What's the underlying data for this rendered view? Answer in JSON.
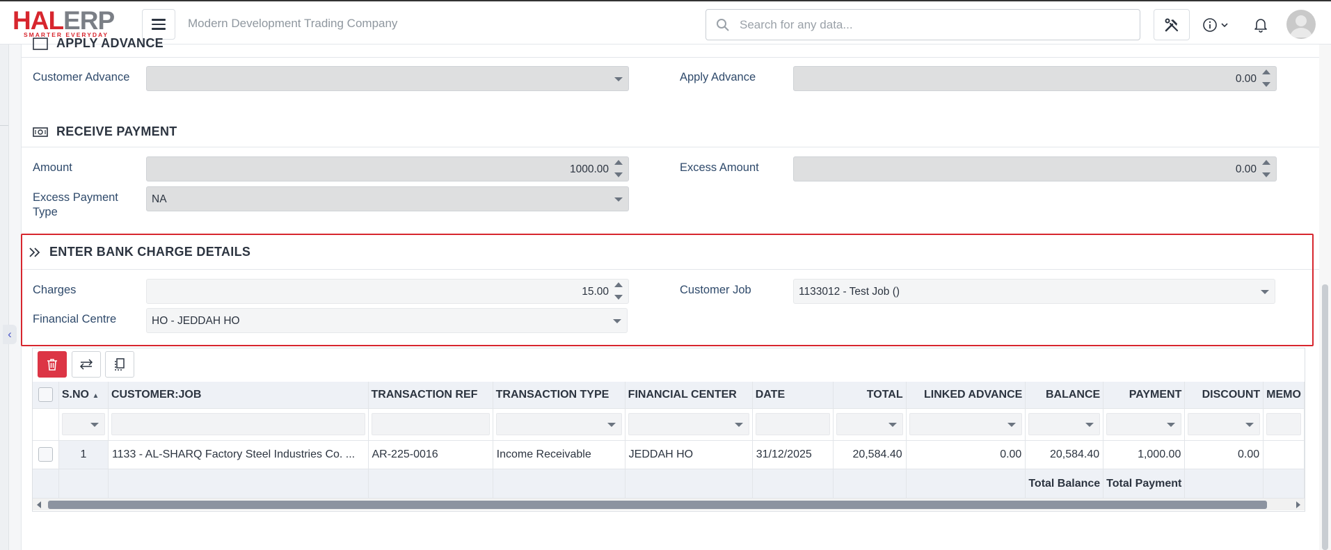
{
  "header": {
    "logo_hal": "HAL",
    "logo_erp": "ERP",
    "logo_tagline": "SMARTER EVERYDAY",
    "company_name": "Modern Development Trading Company",
    "search_placeholder": "Search for any data..."
  },
  "apply_advance": {
    "section_title": "APPLY ADVANCE",
    "customer_advance_label": "Customer Advance",
    "customer_advance_value": "",
    "apply_advance_label": "Apply Advance",
    "apply_advance_value": "0.00"
  },
  "receive_payment": {
    "section_title": "RECEIVE PAYMENT",
    "amount_label": "Amount",
    "amount_value": "1000.00",
    "excess_amount_label": "Excess Amount",
    "excess_amount_value": "0.00",
    "excess_payment_type_label": "Excess Payment Type",
    "excess_payment_type_value": "NA"
  },
  "bank_charge": {
    "section_title": "ENTER BANK CHARGE DETAILS",
    "charges_label": "Charges",
    "charges_value": "15.00",
    "customer_job_label": "Customer Job",
    "customer_job_value": "1133012 - Test Job ()",
    "financial_centre_label": "Financial Centre",
    "financial_centre_value": "HO - JEDDAH HO"
  },
  "grid": {
    "columns": {
      "sno": "S.NO",
      "customer_job": "CUSTOMER:JOB",
      "transaction_ref": "TRANSACTION REF",
      "transaction_type": "TRANSACTION TYPE",
      "financial_center": "FINANCIAL CENTER",
      "date": "DATE",
      "total": "TOTAL",
      "linked_advance": "LINKED ADVANCE",
      "balance": "BALANCE",
      "payment": "PAYMENT",
      "discount": "DISCOUNT",
      "memo": "MEMO"
    },
    "rows": [
      {
        "sno": "1",
        "customer_job": "1133 - AL-SHARQ Factory Steel Industries Co. ...",
        "transaction_ref": "AR-225-0016",
        "transaction_type": "Income Receivable",
        "financial_center": "JEDDAH HO",
        "date": "31/12/2025",
        "total": "20,584.40",
        "linked_advance": "0.00",
        "balance": "20,584.40",
        "payment": "1,000.00",
        "discount": "0.00"
      }
    ],
    "footer": {
      "total_balance": "Total Balance",
      "total_payment": "Total Payment"
    }
  },
  "colors": {
    "brand_red": "#d7262e",
    "label_blue": "#2f4a6b",
    "delete_button": "#dc3545"
  }
}
